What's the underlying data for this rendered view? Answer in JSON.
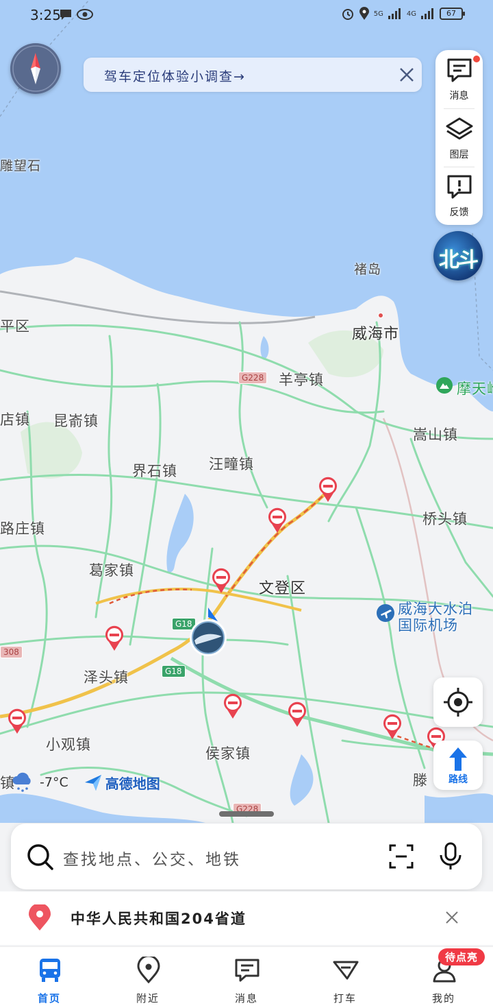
{
  "status_bar": {
    "time": "3:25",
    "battery": "67",
    "signal_1": "5G",
    "signal_2": "4G"
  },
  "survey_banner": {
    "text": "驾车定位体验小调查→"
  },
  "right_panel": {
    "message_label": "消息",
    "layers_label": "图层",
    "feedback_label": "反馈"
  },
  "beidou_badge": "北斗",
  "map": {
    "places": {
      "diaowangshi": "雕望石",
      "ping_qu": "平区",
      "chudao": "褚岛",
      "weihai": "威海市",
      "yangting": "羊亭镇",
      "motian": "摩天岭",
      "dian": "店镇",
      "kunyu": "昆嵛镇",
      "shanshan": "嵩山镇",
      "jieshi": "界石镇",
      "wangtuan": "汪疃镇",
      "luzhuang": "路庄镇",
      "qiaotou": "桥头镇",
      "gejia": "葛家镇",
      "wendeng": "文登区",
      "airport_1": "威海大水泊",
      "airport_2": "国际机场",
      "zetou": "泽头镇",
      "xiaoguan": "小观镇",
      "houjia": "侯家镇",
      "teng": "滕",
      "zhen": "镇"
    },
    "shields": {
      "g228_a": "G228",
      "g18_a": "G18",
      "g18_b": "G18",
      "s308": "308",
      "g228_b": "G228"
    }
  },
  "weather": {
    "temp": "-7°C",
    "icon": "snow-cloud-icon"
  },
  "brand": "高德地图",
  "search": {
    "placeholder": "查找地点、公交、地铁"
  },
  "recent": {
    "text": "中华人民共和国204省道"
  },
  "tabs": [
    {
      "label": "首页",
      "icon": "bus-icon"
    },
    {
      "label": "附近",
      "icon": "location-pin-icon"
    },
    {
      "label": "消息",
      "icon": "message-icon"
    },
    {
      "label": "打车",
      "icon": "taxi-icon"
    },
    {
      "label": "我的",
      "icon": "user-icon"
    }
  ],
  "profile_badge": "待点亮",
  "route_button_label": "路线",
  "colors": {
    "sea": "#a9cdf7",
    "land": "#f2f3f5",
    "road": "#7ed9a3",
    "accent": "#1a73e8",
    "warning": "#e8424f"
  }
}
